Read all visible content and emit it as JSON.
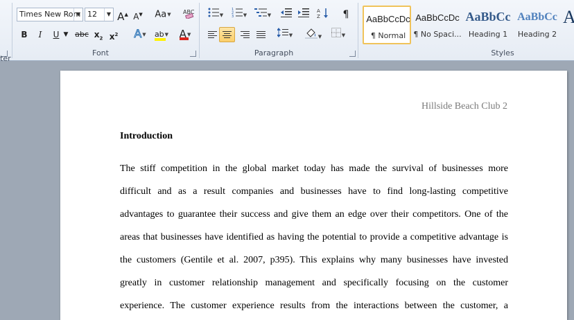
{
  "ribbon": {
    "clipboard_label_tail": "ter",
    "font": {
      "name": "Times New Rom",
      "size": "12",
      "grow": "A",
      "shrink": "A",
      "change_case": "Aa",
      "bold": "B",
      "italic": "I",
      "underline": "U",
      "strike": "abc",
      "subscript": "x",
      "superscript": "x",
      "text_effects": "A",
      "highlight": "ab",
      "font_color": "A",
      "group_label": "Font",
      "font_color_hex": "#d9251d",
      "highlight_hex": "#fff200"
    },
    "paragraph": {
      "pilcrow": "¶",
      "group_label": "Paragraph"
    },
    "styles": {
      "group_label": "Styles",
      "tiles": [
        {
          "preview": "AaBbCcDc",
          "name": "¶ Normal"
        },
        {
          "preview": "AaBbCcDc",
          "name": "¶ No Spaci..."
        },
        {
          "preview": "AaBbCc",
          "name": "Heading 1"
        },
        {
          "preview": "AaBbCc",
          "name": "Heading 2"
        },
        {
          "preview": "A",
          "name": ""
        }
      ]
    }
  },
  "document": {
    "header": "Hillside Beach Club 2",
    "heading": "Introduction",
    "lines": [
      "The stiff competition in the global market today has made the survival of businesses more",
      "difficult and as a result companies and businesses have to find long-lasting competitive",
      "advantages to guarantee their success and give them an edge over their competitors. One of the",
      "areas that businesses have identified as having the potential to provide a competitive advantage is",
      "the customers (Gentile et al. 2007, p395). This explains why many businesses have invested",
      "greatly in customer relationship management and specifically focusing on the customer",
      "experience. The customer experience results from the interactions between the customer, a"
    ]
  }
}
